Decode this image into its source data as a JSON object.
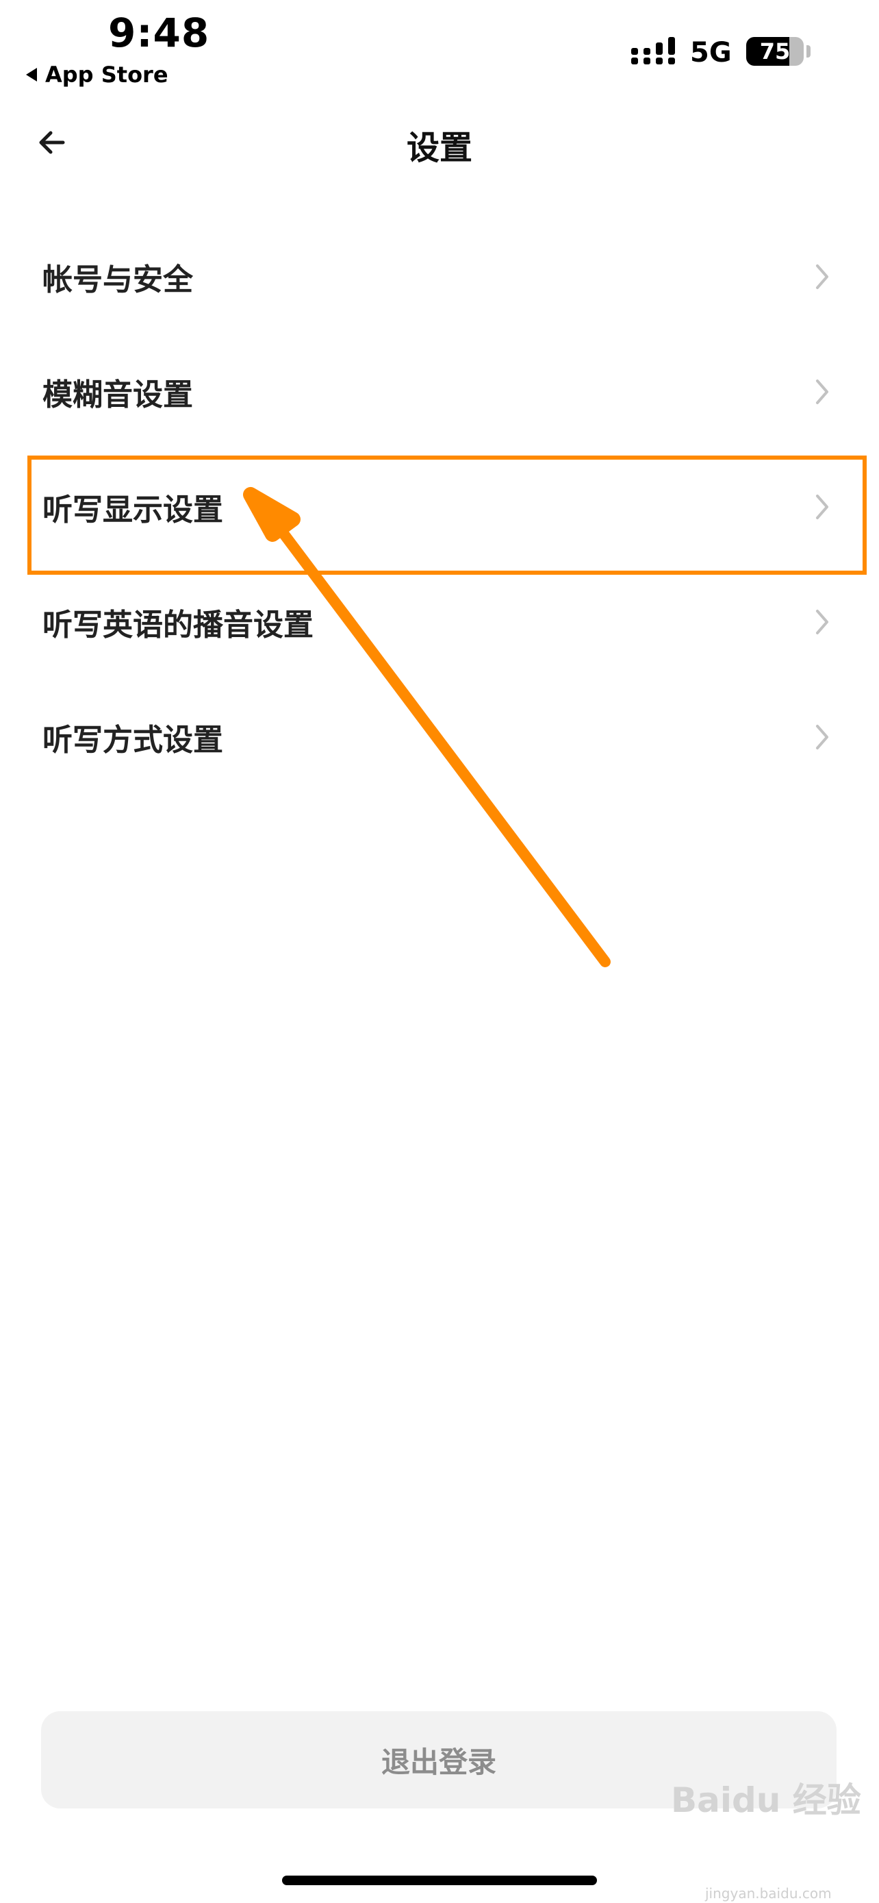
{
  "status_bar": {
    "time": "9:48",
    "back_app": "App Store",
    "network": "5G",
    "battery": "75",
    "battery_level": 0.75
  },
  "nav": {
    "title": "设置",
    "back_icon": "arrow-left-icon"
  },
  "menu": {
    "items": [
      {
        "label": "帐号与安全"
      },
      {
        "label": "模糊音设置"
      },
      {
        "label": "听写显示设置"
      },
      {
        "label": "听写英语的播音设置"
      },
      {
        "label": "听写方式设置"
      }
    ],
    "chevron_icon": "chevron-right-icon"
  },
  "annotation": {
    "color": "#ff8a00"
  },
  "logout_label": "退出登录",
  "watermark": "Baidu 经验",
  "watermark_sub": "jingyan.baidu.com"
}
